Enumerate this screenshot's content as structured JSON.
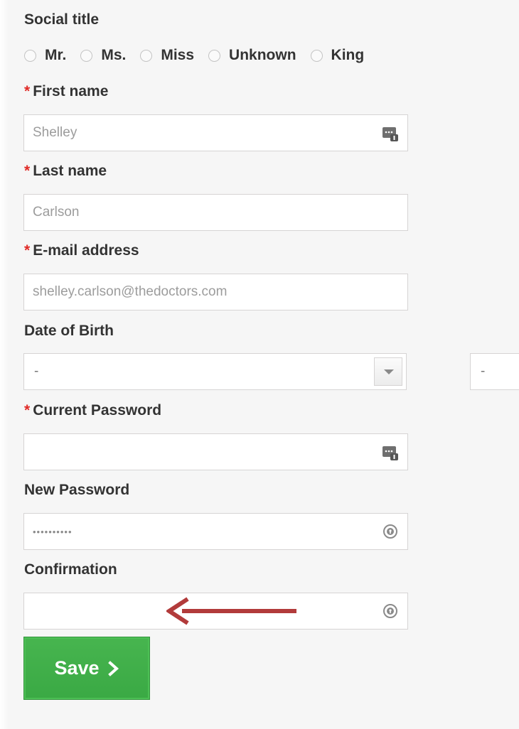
{
  "social_title": {
    "label": "Social title",
    "options": [
      "Mr.",
      "Ms.",
      "Miss",
      "Unknown",
      "King"
    ]
  },
  "required_marker": "*",
  "first_name": {
    "label": "First name",
    "placeholder": "Shelley",
    "icon": "password-manager-icon"
  },
  "last_name": {
    "label": "Last name",
    "placeholder": "Carlson"
  },
  "email": {
    "label": "E-mail address",
    "placeholder": "shelley.carlson@thedoctors.com"
  },
  "date_of_birth": {
    "label": "Date of Birth",
    "day_value": "-",
    "month_value": "-"
  },
  "current_password": {
    "label": "Current Password",
    "value": "",
    "icon": "password-manager-icon"
  },
  "new_password": {
    "label": "New Password",
    "value": "••••••••••",
    "icon": "password-key-icon"
  },
  "confirmation": {
    "label": "Confirmation",
    "value": "",
    "icon": "password-key-icon"
  },
  "save_button": {
    "label": "Save",
    "icon": "chevron-right-icon"
  },
  "colors": {
    "background": "#f6f6f6",
    "required": "#e02b27",
    "button": "#3fae48",
    "annotation_arrow": "#b23b3b"
  }
}
